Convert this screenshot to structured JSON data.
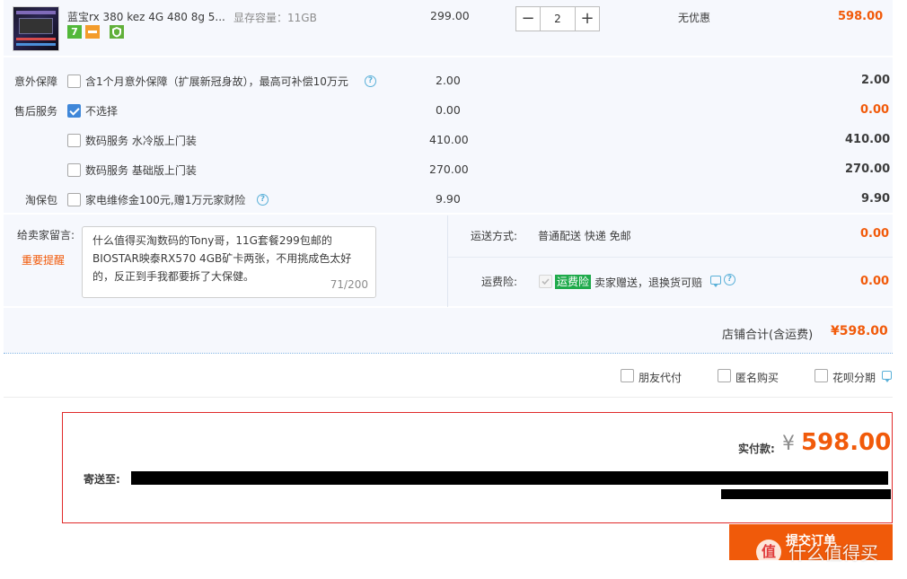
{
  "product": {
    "title": "蓝宝rx 380 kez 4G 480 8g 5...",
    "spec": "显存容量：11GB",
    "badge_seven": "7",
    "unit_price": "299.00",
    "quantity": "2",
    "decrease_label": "−",
    "increase_label": "+",
    "discount": "无优惠",
    "subtotal": "598.00"
  },
  "services": {
    "accident": {
      "section_label": "意外保障",
      "item_label": "含1个月意外保障（扩展新冠身故），最高可补偿10万元",
      "price": "2.00",
      "total": "2.00",
      "checked": false
    },
    "after_sales": {
      "section_label": "售后服务",
      "items": [
        {
          "label": "不选择",
          "price": "0.00",
          "total": "0.00",
          "checked": true
        },
        {
          "label": "数码服务 水冷版上门装",
          "price": "410.00",
          "total": "410.00",
          "checked": false
        },
        {
          "label": "数码服务 基础版上门装",
          "price": "270.00",
          "total": "270.00",
          "checked": false
        }
      ]
    },
    "taobao_protect": {
      "section_label": "淘保包",
      "item_label": "家电维修金100元,赠1万元家财险",
      "price": "9.90",
      "total": "9.90",
      "checked": false
    }
  },
  "message": {
    "label": "给卖家留言:",
    "link": "重要提醒",
    "lines": [
      "什么值得买淘数码的Tony哥，11G套餐299包邮的",
      "BIOSTAR映泰RX570 4GB矿卡两张，不用挑成色太好",
      "的，反正到手我都要拆了大保健。"
    ],
    "count": "71/200"
  },
  "shipping": {
    "method_label": "运送方式:",
    "method_value": "普通配送 快递 免邮",
    "method_price": "0.00",
    "insurance_label": "运费险:",
    "insurance_tag": "运费险",
    "insurance_desc": "卖家赠送，退换货可赔",
    "insurance_price": "0.00"
  },
  "store_total": {
    "label": "店铺合计(含运费)",
    "value": "¥598.00"
  },
  "payment_options": [
    {
      "label": "朋友代付"
    },
    {
      "label": "匿名购买"
    },
    {
      "label": "花呗分期"
    }
  ],
  "order": {
    "actual_label": "实付款:",
    "currency": "¥",
    "actual_value": "598.00",
    "ship_to_label": "寄送至:"
  },
  "submit_label": "提交订单",
  "watermark": {
    "logo": "值",
    "text": "什么值得买"
  },
  "colors": {
    "accent": "#f15a0a",
    "panel_bg": "#f6f8fd",
    "checkbox_blue": "#3f87d9",
    "tag_green": "#1faa4b",
    "order_border": "#e02a2a"
  }
}
